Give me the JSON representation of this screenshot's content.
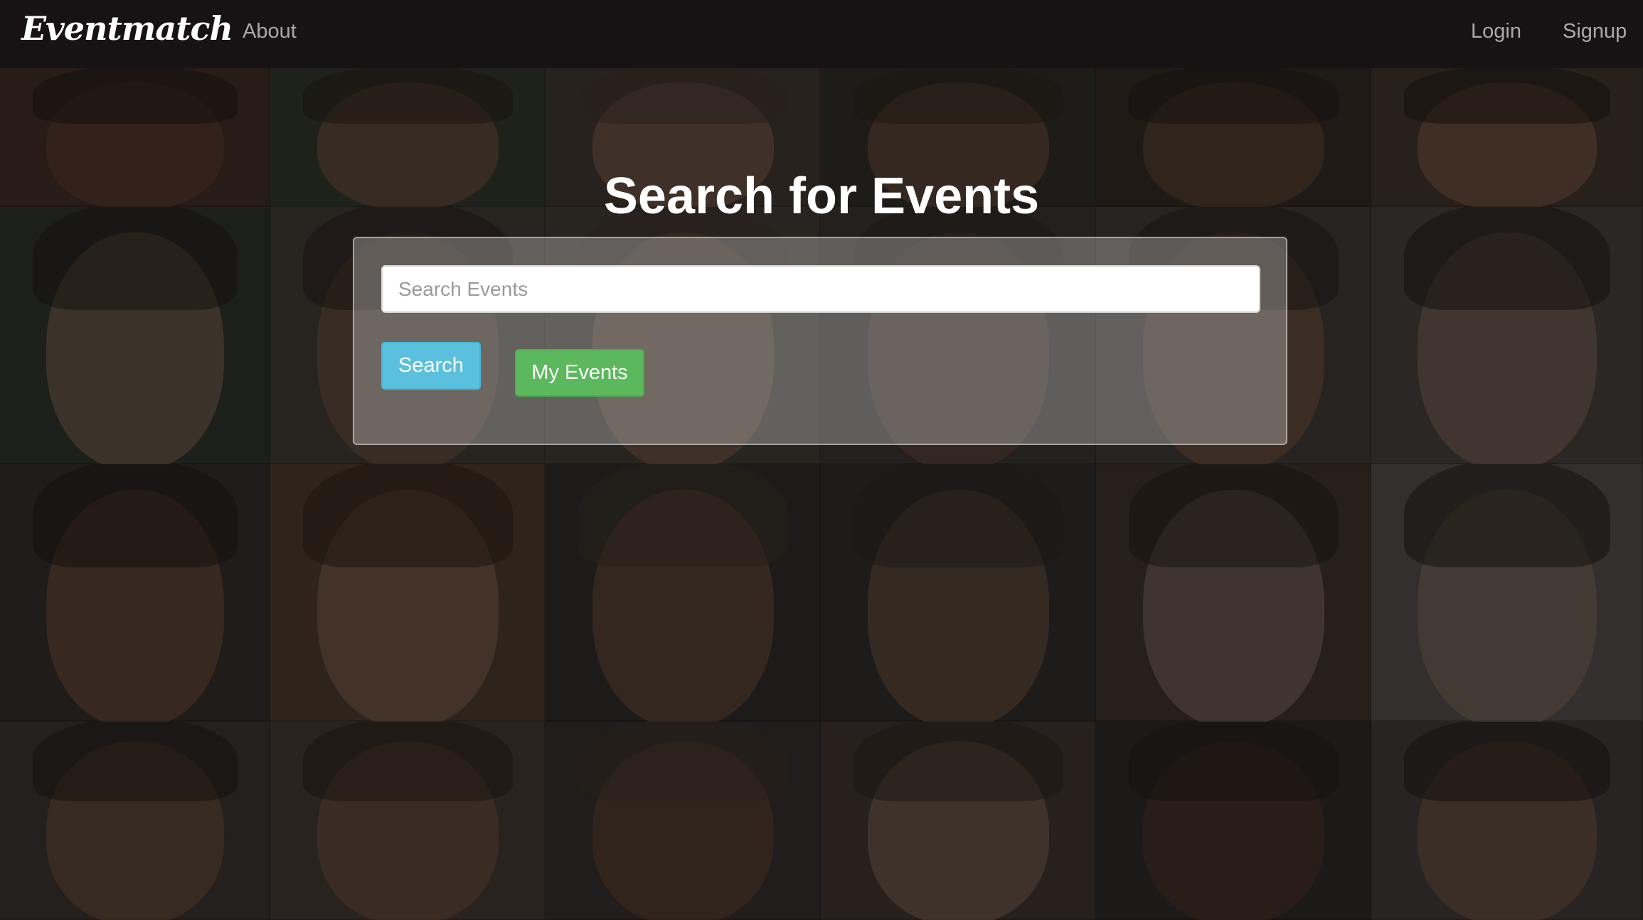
{
  "navbar": {
    "brand": "Eventmatch",
    "links": {
      "about": "About",
      "login": "Login",
      "signup": "Signup"
    }
  },
  "hero": {
    "title": "Search for Events",
    "search": {
      "placeholder": "Search Events",
      "value": ""
    },
    "buttons": {
      "search": "Search",
      "my_events": "My Events"
    }
  },
  "colors": {
    "navbar_bg": "#171314",
    "search_button": "#5bc0de",
    "my_events_button": "#5cb85c"
  }
}
